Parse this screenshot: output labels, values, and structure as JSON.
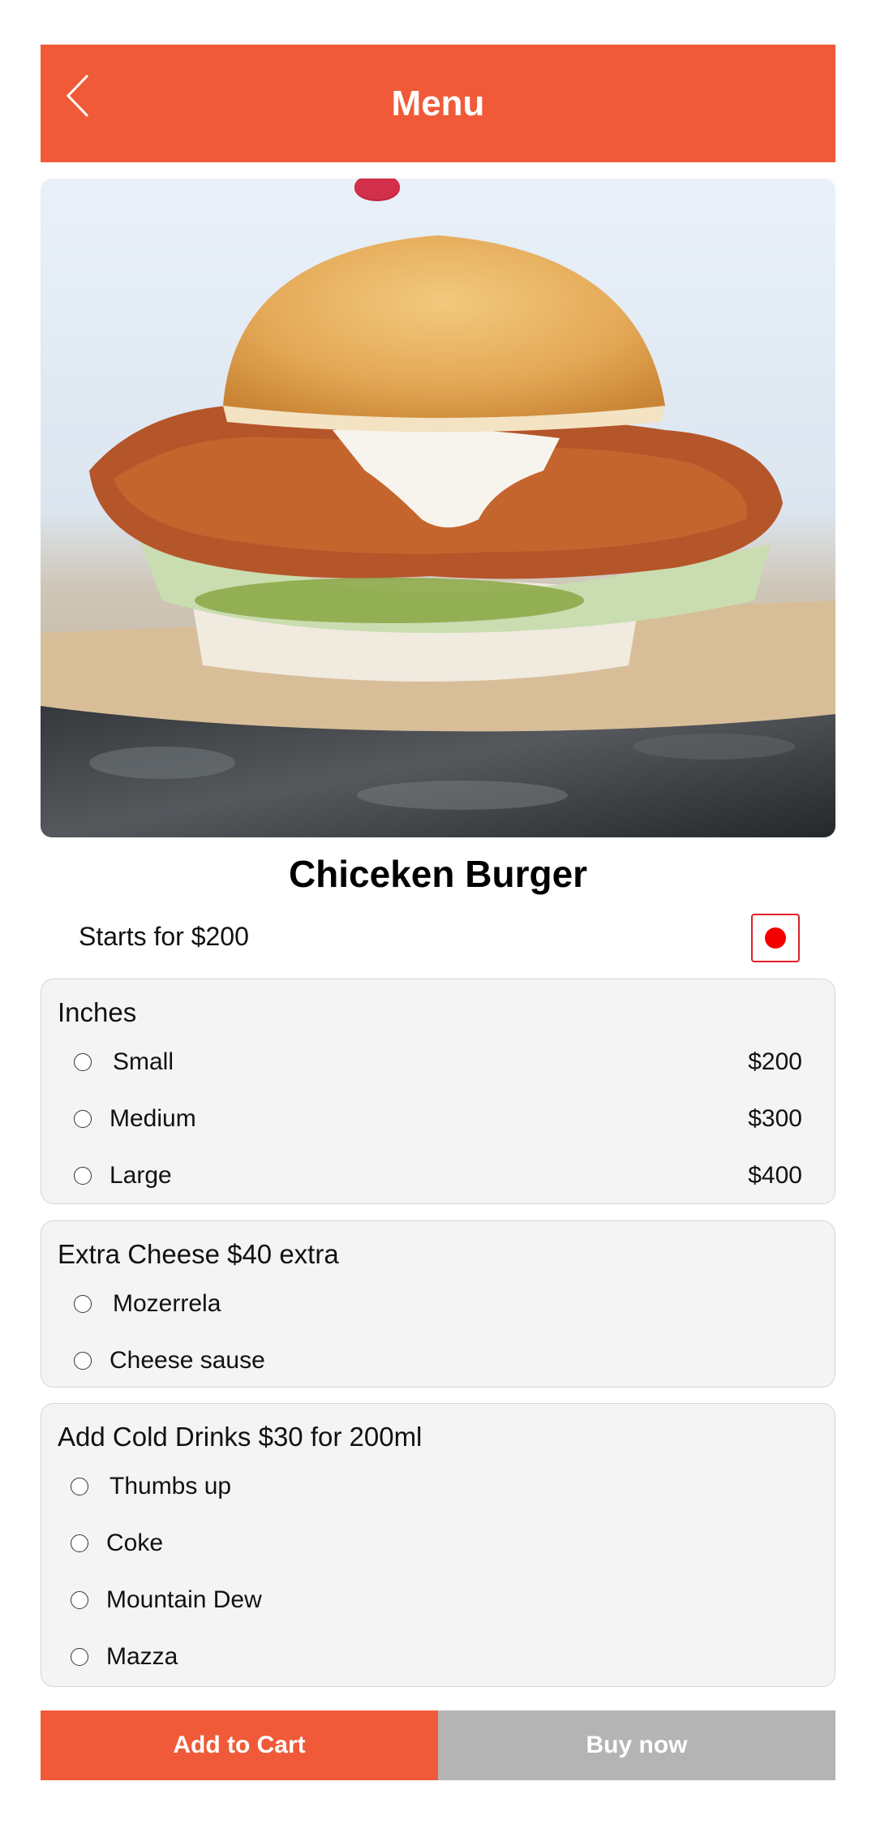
{
  "header": {
    "title": "Menu",
    "back_icon": "chevron-left-icon"
  },
  "product": {
    "name": "Chiceken Burger",
    "price_from": "Starts for $200",
    "image": "chicken-burger-photo",
    "indicator_color": "#F20000"
  },
  "size_group": {
    "title": "Inches",
    "options": [
      {
        "label": "Small",
        "price": "$200"
      },
      {
        "label": "Medium",
        "price": "$300"
      },
      {
        "label": "Large",
        "price": "$400"
      }
    ]
  },
  "cheese_group": {
    "title": "Extra  Cheese $40 extra",
    "options": [
      {
        "label": "Mozerrela"
      },
      {
        "label": "Cheese sause"
      }
    ]
  },
  "drinks_group": {
    "title": "Add Cold Drinks $30 for 200ml",
    "options": [
      {
        "label": "Thumbs up"
      },
      {
        "label": "Coke"
      },
      {
        "label": "Mountain Dew"
      },
      {
        "label": "Mazza"
      }
    ]
  },
  "actions": {
    "add_to_cart": "Add to Cart",
    "buy_now": "Buy now"
  },
  "colors": {
    "accent": "#F05A38",
    "secondary_button": "#B4B4B4",
    "panel": "#F4F4F4"
  }
}
